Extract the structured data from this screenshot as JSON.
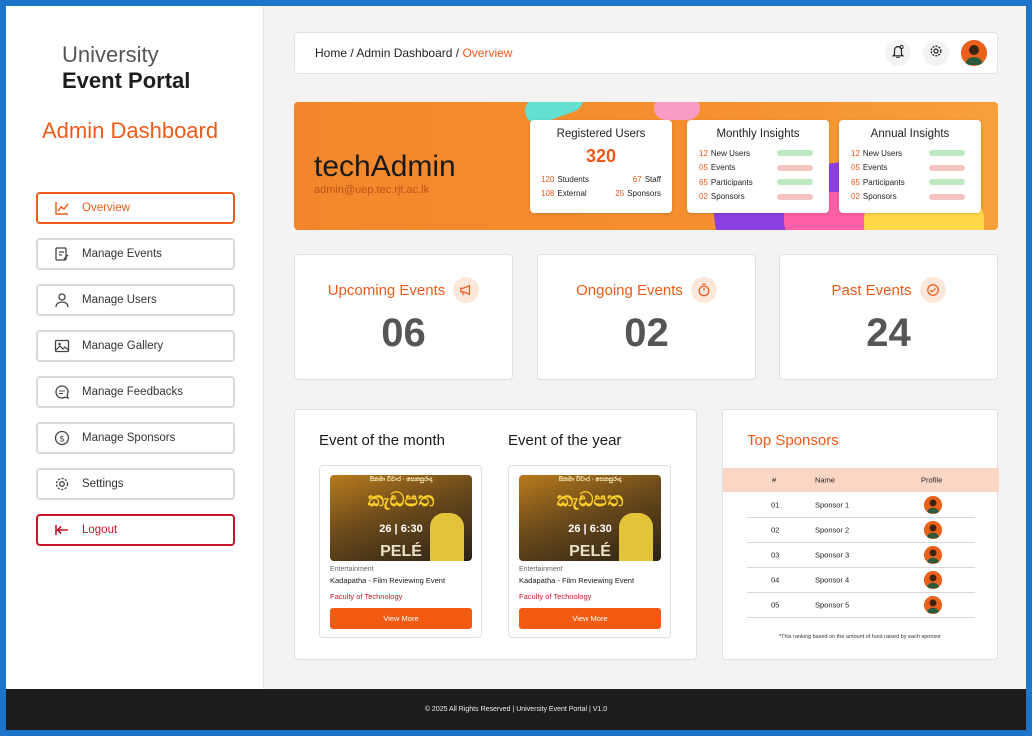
{
  "brand": {
    "line1": "University",
    "line2": "Event Portal"
  },
  "sidebar": {
    "title": "Admin Dashboard",
    "items": [
      {
        "label": "Overview",
        "icon": "chart-line-icon",
        "active": true
      },
      {
        "label": "Manage Events",
        "icon": "edit-calendar-icon"
      },
      {
        "label": "Manage Users",
        "icon": "user-icon"
      },
      {
        "label": "Manage Gallery",
        "icon": "image-icon"
      },
      {
        "label": "Manage Feedbacks",
        "icon": "chat-icon"
      },
      {
        "label": "Manage Sponsors",
        "icon": "dollar-icon"
      },
      {
        "label": "Settings",
        "icon": "gear-icon"
      }
    ],
    "logout": "Logout"
  },
  "breadcrumb": {
    "home": "Home",
    "sep": " / ",
    "section": "Admin Dashboard",
    "current": "Overview"
  },
  "topbar": {
    "icons": [
      "bell-icon",
      "gear-icon",
      "avatar"
    ]
  },
  "banner": {
    "name": "techAdmin",
    "email": "admin@uep.tec.rjt.ac.lk",
    "registered": {
      "title": "Registered Users",
      "total": "320",
      "students_num": "120",
      "students_lbl": "Students",
      "staff_num": "67",
      "staff_lbl": "Staff",
      "external_num": "108",
      "external_lbl": "External",
      "sponsors_num": "25",
      "sponsors_lbl": "Sponsors"
    },
    "monthly": {
      "title": "Monthly Insights",
      "rows": [
        {
          "num": "12",
          "label": "New Users",
          "trend": "up"
        },
        {
          "num": "05",
          "label": "Events",
          "trend": "down"
        },
        {
          "num": "65",
          "label": "Participants",
          "trend": "up"
        },
        {
          "num": "02",
          "label": "Sponsors",
          "trend": "down"
        }
      ]
    },
    "annual": {
      "title": "Annual Insights",
      "rows": [
        {
          "num": "12",
          "label": "New Users",
          "trend": "up"
        },
        {
          "num": "05",
          "label": "Events",
          "trend": "down"
        },
        {
          "num": "65",
          "label": "Participants",
          "trend": "up"
        },
        {
          "num": "02",
          "label": "Sponsors",
          "trend": "down"
        }
      ]
    }
  },
  "stats": {
    "upcoming": {
      "label": "Upcoming Events",
      "value": "06",
      "icon": "megaphone-icon"
    },
    "ongoing": {
      "label": "Ongoing Events",
      "value": "02",
      "icon": "stopwatch-icon"
    },
    "past": {
      "label": "Past Events",
      "value": "24",
      "icon": "check-circle-icon"
    }
  },
  "events": {
    "month": {
      "heading": "Event of the month",
      "poster": {
        "line1": "සිනමා විචාර · සෙනසුරාදා",
        "title": "කැඩපත",
        "time": "26 | 6:30",
        "sub": "PELÉ"
      },
      "category": "Entertainment",
      "title": "Kadapatha - Film Reviewing Event",
      "faculty": "Faculty of Technology",
      "button": "View More"
    },
    "year": {
      "heading": "Event of the year",
      "poster": {
        "line1": "සිනමා විචාර · සෙනසුරාදා",
        "title": "කැඩපත",
        "time": "26 | 6:30",
        "sub": "PELÉ"
      },
      "category": "Entertainment",
      "title": "Kadapatha - Film Reviewing Event",
      "faculty": "Faculty of Technology",
      "button": "View More"
    }
  },
  "sponsors": {
    "title": "Top Sponsors",
    "headers": {
      "num": "#",
      "name": "Name",
      "profile": "Profile"
    },
    "rows": [
      {
        "num": "01",
        "name": "Sponsor 1"
      },
      {
        "num": "02",
        "name": "Sponsor 2"
      },
      {
        "num": "03",
        "name": "Sponsor 3"
      },
      {
        "num": "04",
        "name": "Sponsor 4"
      },
      {
        "num": "05",
        "name": "Sponsor 5"
      }
    ],
    "note": "*This  ranking based on the amount of fund raised by each sponsor"
  },
  "footer": {
    "text": "© 2025 All Rights Reserved | University Event Portal | V1.0"
  },
  "colors": {
    "accent": "#ef5a19",
    "logout": "#c5162b",
    "footer": "#1c1c1c"
  }
}
